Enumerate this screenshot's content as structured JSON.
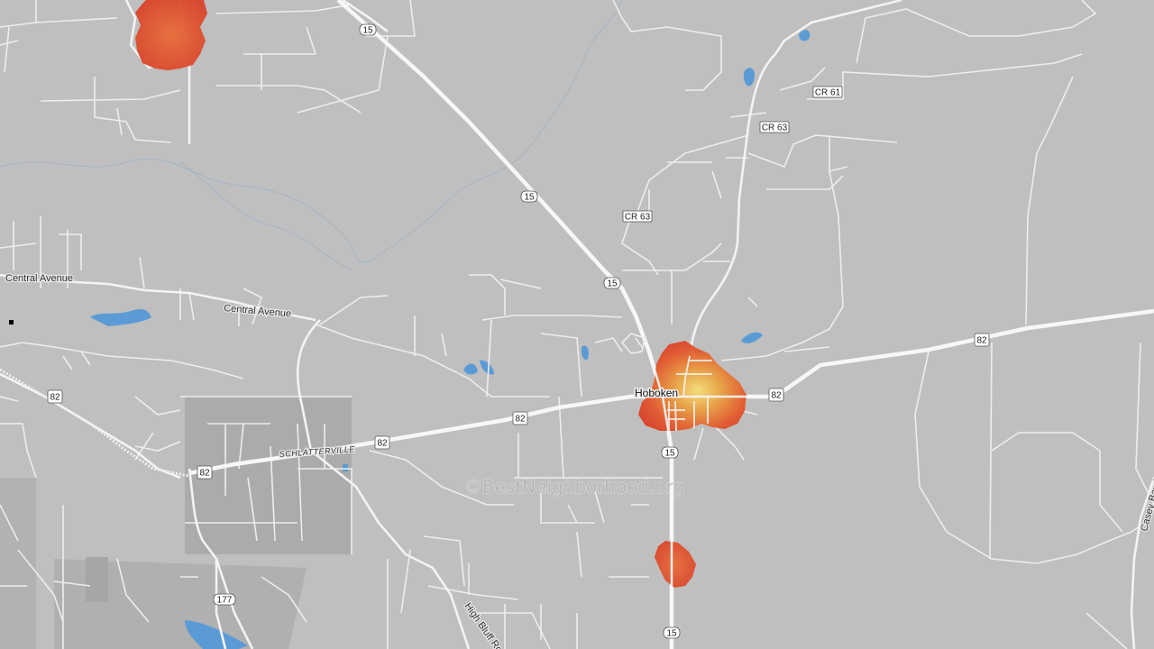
{
  "map": {
    "town_label": "Hoboken",
    "watermark": "©BestNeighborhood.org",
    "road_labels": {
      "central_avenue_west": "Central Avenue",
      "central_avenue_east": "Central Avenue",
      "schlatterville": "SCHLATTERVILLE",
      "high_bluff_road": "High Bluff Roa",
      "casey_bay_road": "Casey Bay R"
    },
    "shields": {
      "r15a": "15",
      "r15b": "15",
      "r15c": "15",
      "r15d": "15",
      "r15e": "15",
      "us82a": "82",
      "us82b": "82",
      "us82c": "82",
      "us82d": "82",
      "us82e": "82",
      "us82f": "82",
      "cr61": "CR 61",
      "cr63a": "CR 63",
      "cr63b": "CR 63",
      "r177": "177"
    },
    "colors": {
      "background": "#bfbfbf",
      "road": "#f5f5f5",
      "water": "#5b9bd5",
      "heat_low": "#e04a2c",
      "heat_mid": "#e57a3a",
      "heat_high": "#f2d36b"
    }
  }
}
